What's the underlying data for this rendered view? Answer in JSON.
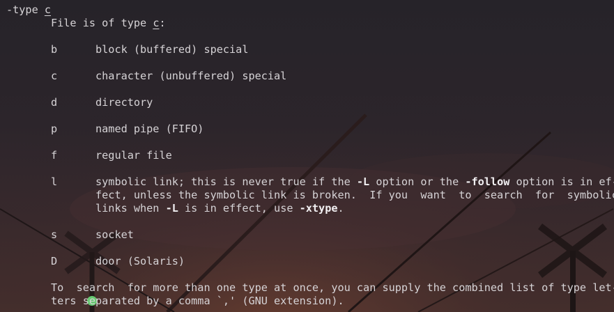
{
  "lines": [
    [
      {
        "t": "-type "
      },
      {
        "t": "c",
        "s": "u"
      }
    ],
    [
      {
        "t": "       File is of type "
      },
      {
        "t": "c",
        "s": "u"
      },
      {
        "t": ":"
      }
    ],
    [],
    [
      {
        "t": "       b      block (buffered) special"
      }
    ],
    [],
    [
      {
        "t": "       c      character (unbuffered) special"
      }
    ],
    [],
    [
      {
        "t": "       d      directory"
      }
    ],
    [],
    [
      {
        "t": "       p      named pipe (FIFO)"
      }
    ],
    [],
    [
      {
        "t": "       f      regular file"
      }
    ],
    [],
    [
      {
        "t": "       l      symbolic link; this is never true if the "
      },
      {
        "t": "-L",
        "s": "b"
      },
      {
        "t": " option or the "
      },
      {
        "t": "-follow",
        "s": "b"
      },
      {
        "t": " option is in ef-"
      }
    ],
    [
      {
        "t": "              fect, unless the symbolic link is broken.  If you  want  to  search  for  symbolic"
      }
    ],
    [
      {
        "t": "              links when "
      },
      {
        "t": "-L",
        "s": "b"
      },
      {
        "t": " is in effect, use "
      },
      {
        "t": "-xtype",
        "s": "b"
      },
      {
        "t": "."
      }
    ],
    [],
    [
      {
        "t": "       s      socket"
      }
    ],
    [],
    [
      {
        "t": "       D      door (Solaris)"
      }
    ],
    [],
    [
      {
        "t": "       To  search  for more than one type at once, you can supply the combined list of type let-"
      }
    ],
    [
      {
        "t": "       ters separated by a comma `,' (GNU extension)."
      }
    ]
  ]
}
